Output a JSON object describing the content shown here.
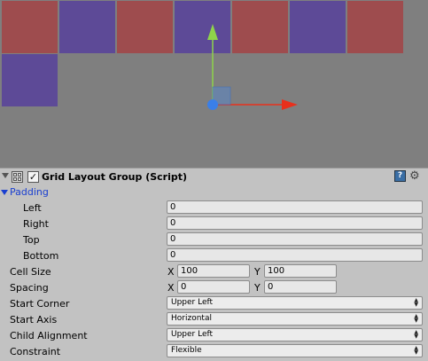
{
  "scene": {
    "cells_row1": [
      "red",
      "blue",
      "red",
      "blue",
      "red",
      "blue",
      "red"
    ],
    "cells_row2": [
      "blue"
    ],
    "colors": {
      "red": "#9e4c4e",
      "blue": "#5d4a97",
      "background": "#7f7f7f",
      "y_axis": "#8fd44a",
      "x_axis": "#e8301c",
      "pivot": "#3a7fe8"
    }
  },
  "component": {
    "title": "Grid Layout Group (Script)",
    "enabled_check": "✓",
    "help_symbol": "?",
    "settings_symbol": "⚙",
    "padding": {
      "label": "Padding",
      "left_label": "Left",
      "left_value": "0",
      "right_label": "Right",
      "right_value": "0",
      "top_label": "Top",
      "top_value": "0",
      "bottom_label": "Bottom",
      "bottom_value": "0"
    },
    "cell_size": {
      "label": "Cell Size",
      "x_axis": "X",
      "x_value": "100",
      "y_axis": "Y",
      "y_value": "100"
    },
    "spacing": {
      "label": "Spacing",
      "x_axis": "X",
      "x_value": "0",
      "y_axis": "Y",
      "y_value": "0"
    },
    "start_corner": {
      "label": "Start Corner",
      "value": "Upper Left"
    },
    "start_axis": {
      "label": "Start Axis",
      "value": "Horizontal"
    },
    "child_alignment": {
      "label": "Child Alignment",
      "value": "Upper Left"
    },
    "constraint": {
      "label": "Constraint",
      "value": "Flexible"
    }
  }
}
